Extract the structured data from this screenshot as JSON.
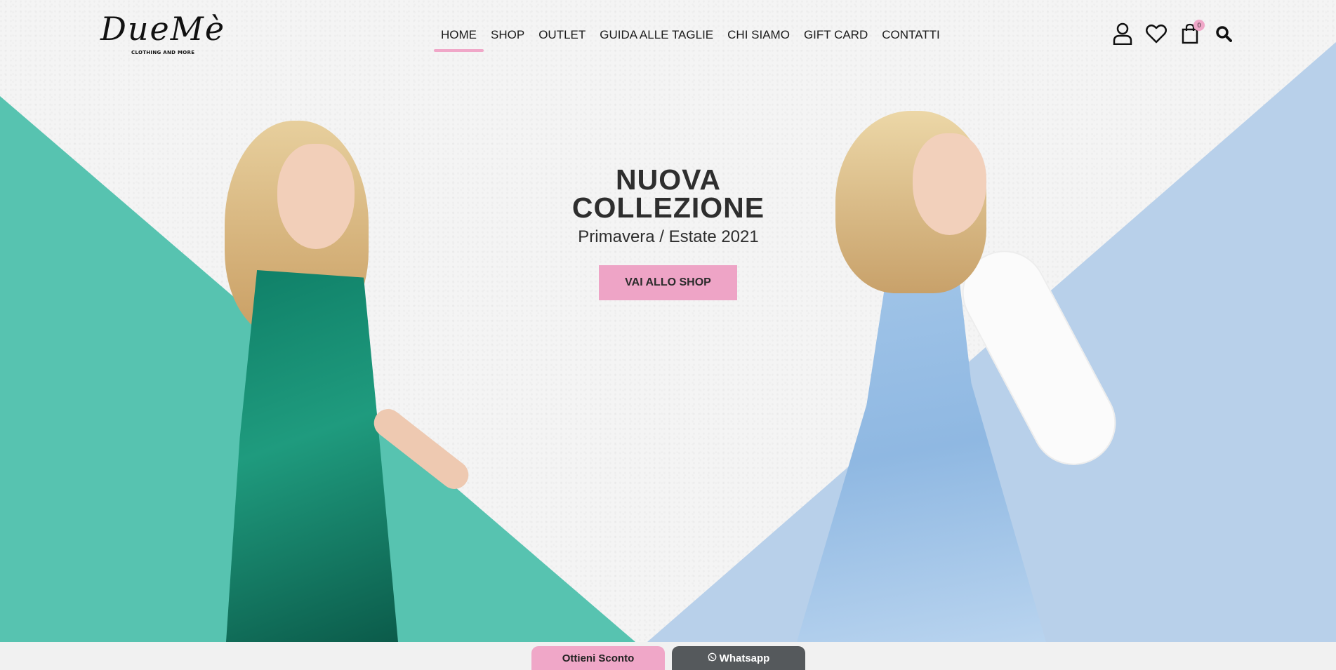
{
  "brand": {
    "logo_script": "DueMè",
    "logo_tagline": "CLOTHING AND MORE"
  },
  "nav": {
    "items": [
      {
        "label": "HOME",
        "active": true
      },
      {
        "label": "SHOP"
      },
      {
        "label": "OUTLET"
      },
      {
        "label": "GUIDA ALLE TAGLIE"
      },
      {
        "label": "CHI SIAMO"
      },
      {
        "label": "GIFT CARD"
      },
      {
        "label": "CONTATTI"
      }
    ]
  },
  "header_icons": {
    "account": "user-icon",
    "wishlist": "heart-icon",
    "cart": "shopping-bag-icon",
    "cart_count": "0",
    "search": "search-icon"
  },
  "hero": {
    "title_line1": "NUOVA",
    "title_line2": "COLLEZIONE",
    "subtitle": "Primavera / Estate 2021",
    "cta_label": "VAI ALLO SHOP"
  },
  "bottom_bar": {
    "discount_label": "Ottieni Sconto",
    "whatsapp_label": "Whatsapp"
  },
  "colors": {
    "accent_pink": "#f0a7c8",
    "teal": "#57c3b0",
    "light_blue": "#b8d0ea",
    "dark_gray": "#55595c"
  }
}
